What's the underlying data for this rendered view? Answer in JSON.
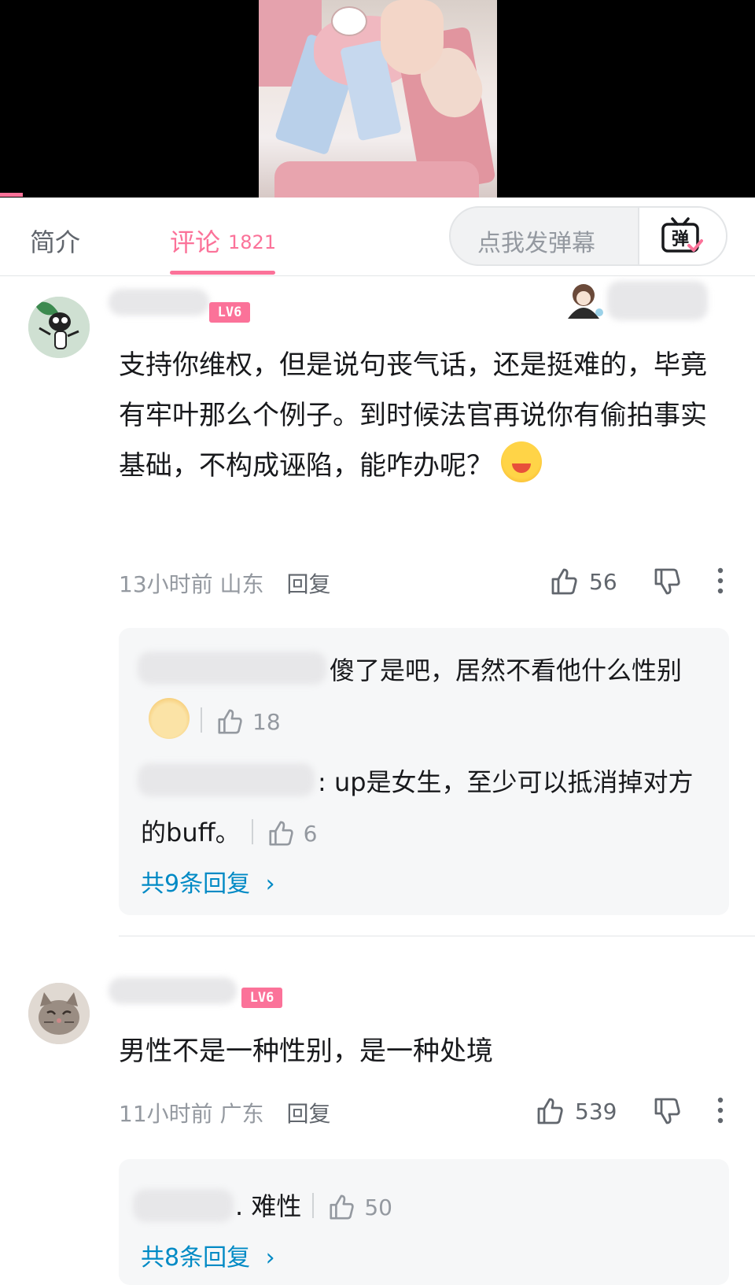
{
  "tabs": {
    "intro_label": "简介",
    "comments_label": "评论",
    "comments_count": "1821"
  },
  "danmaku": {
    "placeholder": "点我发弹幕",
    "button_glyph": "弹"
  },
  "comments": [
    {
      "level": "LV6",
      "text": "支持你维权，但是说句丧气话，还是挺难的，毕竟有牢叶那么个例子。到时候法官再说你有偷拍事实基础，不构成诬陷，能咋办呢？",
      "time": "13小时前",
      "location": "山东",
      "reply_label": "回复",
      "likes": "56",
      "replies": [
        {
          "text": "傻了是吧，居然不看他什么性别",
          "likes": "18"
        },
        {
          "text": ": up是女生，至少可以抵消掉对方的buff。",
          "likes": "6"
        }
      ],
      "more_replies": "共9条回复"
    },
    {
      "level": "LV6",
      "text": "男性不是一种性别，是一种处境",
      "time": "11小时前",
      "location": "广东",
      "reply_label": "回复",
      "likes": "539",
      "replies": [
        {
          "text": ". 难性",
          "likes": "50"
        }
      ],
      "more_replies": "共8条回复"
    }
  ],
  "colors": {
    "accent": "#fb7299",
    "link": "#008ac5",
    "muted": "#9499a0"
  }
}
